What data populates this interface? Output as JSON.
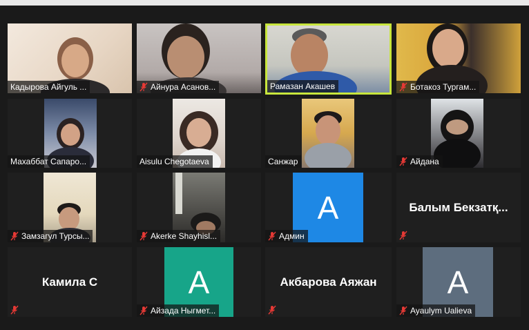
{
  "participants": [
    {
      "name": "Кадырова Айгуль ...",
      "muted": false,
      "video": true
    },
    {
      "name": "Айнура Асанов...",
      "muted": true,
      "video": true
    },
    {
      "name": "Рамазан Акашев",
      "muted": false,
      "video": true,
      "active_speaker": true
    },
    {
      "name": "Ботакоз Тургам...",
      "muted": true,
      "video": true
    },
    {
      "name": "Махаббат Сапаро...",
      "muted": false,
      "video": true
    },
    {
      "name": "Aisulu Chegotaeva",
      "muted": false,
      "video": true
    },
    {
      "name": "Санжар",
      "muted": false,
      "video": true
    },
    {
      "name": "Айдана",
      "muted": true,
      "video": true
    },
    {
      "name": "Замзагул Турсы...",
      "muted": true,
      "video": true
    },
    {
      "name": "Akerke Shayhisl...",
      "muted": true,
      "video": true
    },
    {
      "name": "Админ",
      "muted": true,
      "video": false,
      "avatar_letter": "A",
      "avatar_color": "#1e88e5"
    },
    {
      "name": "Балым Бекзатқ...",
      "muted": true,
      "video": false
    },
    {
      "name": "Камила С",
      "muted": true,
      "video": false
    },
    {
      "name": "Айзада Ныгмет...",
      "muted": true,
      "video": false,
      "avatar_letter": "A",
      "avatar_color": "#17a589"
    },
    {
      "name": "Акбарова Аяжан",
      "muted": true,
      "video": false
    },
    {
      "name": "Ayaulym Ualieva",
      "muted": true,
      "video": false,
      "avatar_letter": "A",
      "avatar_color": "#5d6d7e"
    }
  ],
  "colors": {
    "active_border": "#c8e63c",
    "mute_icon": "#e53935",
    "tile_background": "#1f1f1f"
  },
  "icons": {
    "mute": "muted-microphone-icon"
  }
}
